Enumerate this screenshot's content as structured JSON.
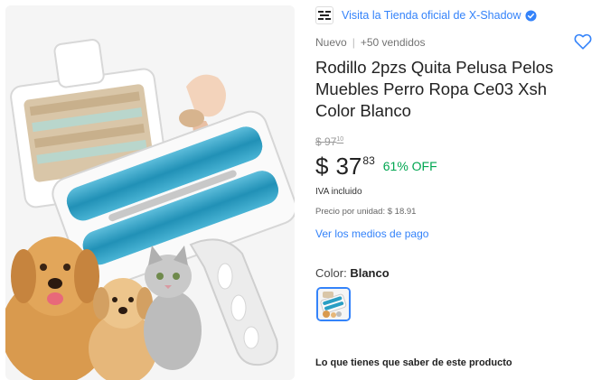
{
  "store": {
    "logo_text": "X-SHADOW",
    "link_text": "Visita la Tienda oficial de X-Shadow"
  },
  "meta": {
    "condition": "Nuevo",
    "sold": "+50 vendidos"
  },
  "product": {
    "title": "Rodillo 2pzs Quita Pelusa Pelos Muebles Perro Ropa Ce03 Xsh Color Blanco"
  },
  "price": {
    "old_currency": "$",
    "old_int": "97",
    "old_cents": "10",
    "currency": "$",
    "int": "37",
    "cents": "83",
    "discount": "61% OFF",
    "tax_note": "IVA incluido",
    "unit_price": "Precio por unidad: $ 18.91",
    "payment_link": "Ver los medios de pago"
  },
  "variant": {
    "label": "Color:",
    "value": "Blanco"
  },
  "section": {
    "title": "Lo que tienes que saber de este producto"
  },
  "colors": {
    "link": "#3483fa",
    "discount": "#00a650",
    "accent_teal": "#2a9fc4"
  }
}
